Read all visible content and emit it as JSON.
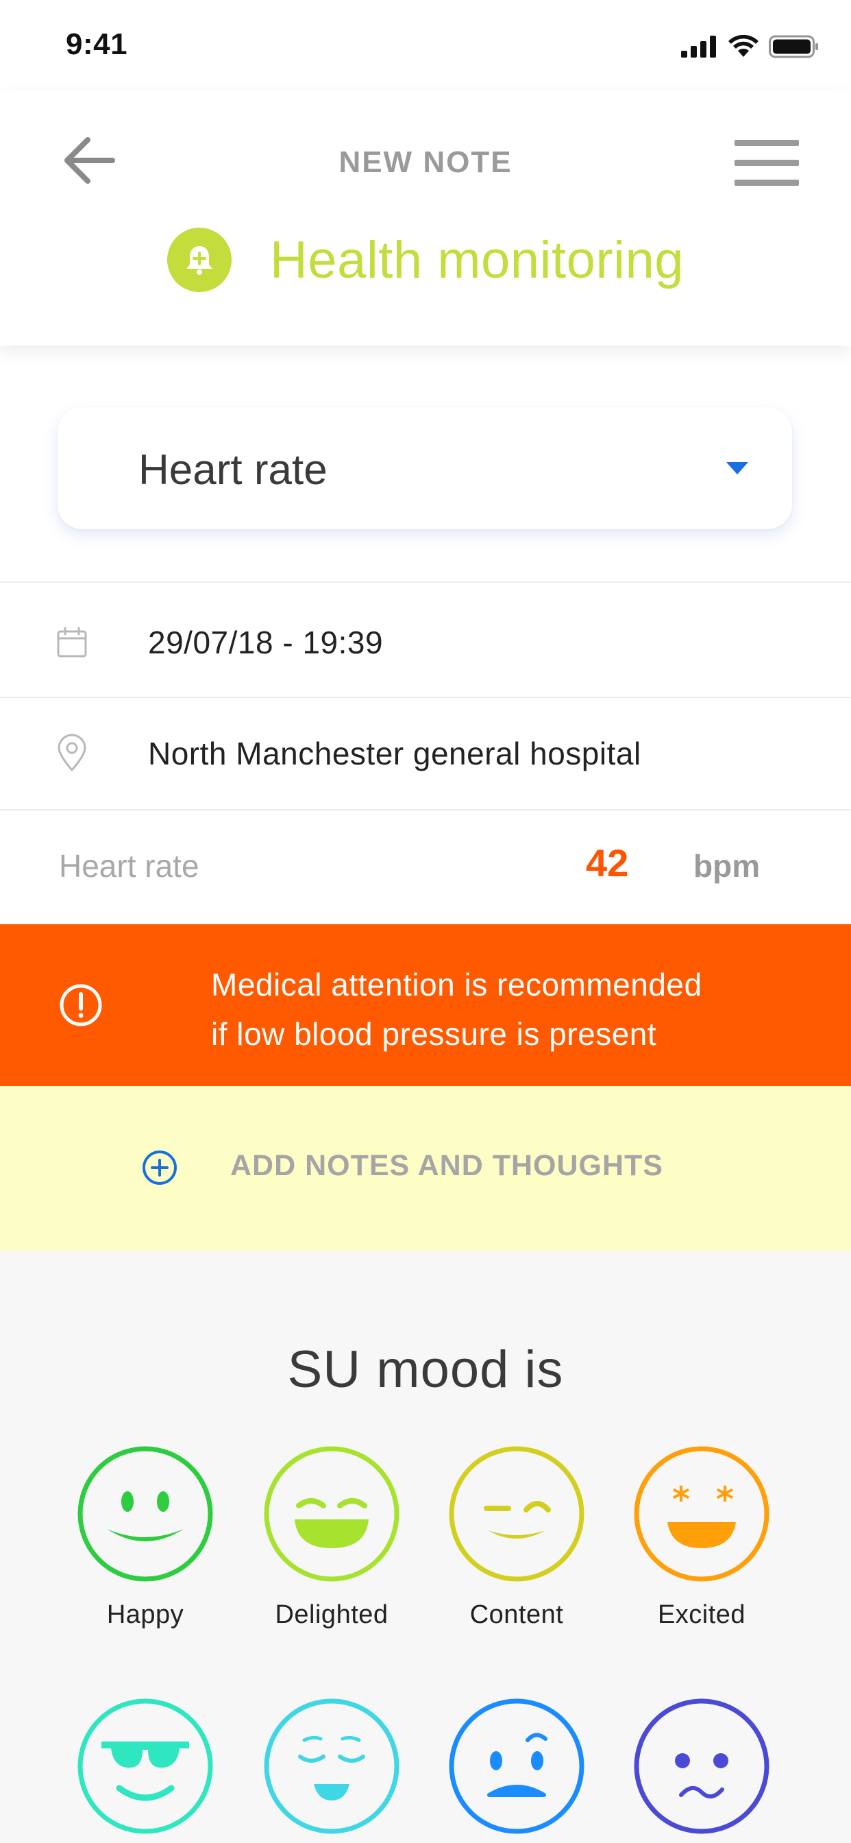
{
  "status_bar": {
    "time": "9:41"
  },
  "header": {
    "title": "NEW NOTE",
    "category": "Health monitoring",
    "accent_color": "#c4dc3c"
  },
  "select": {
    "value": "Heart rate"
  },
  "details": {
    "datetime": "29/07/18 - 19:39",
    "location": "North Manchester general hospital"
  },
  "reading": {
    "label": "Heart rate",
    "value": "42",
    "unit": "bpm",
    "value_color": "#ff5500"
  },
  "alert": {
    "line1": "Medical attention is recommended",
    "line2": "if low blood pressure is present",
    "color": "#ff5a00"
  },
  "notes": {
    "label": "ADD NOTES AND THOUGHTS"
  },
  "mood": {
    "title": "SU mood is",
    "options": [
      {
        "label": "Happy",
        "icon": "happy-face-icon",
        "color": "#2ecc40"
      },
      {
        "label": "Delighted",
        "icon": "delighted-face-icon",
        "color": "#a6e22e"
      },
      {
        "label": "Content",
        "icon": "content-face-icon",
        "color": "#d4cf1e"
      },
      {
        "label": "Excited",
        "icon": "excited-face-icon",
        "color": "#ff9f0a"
      },
      {
        "label": "",
        "icon": "cool-sunglasses-face-icon",
        "color": "#2ee6c0"
      },
      {
        "label": "",
        "icon": "relaxed-face-icon",
        "color": "#3fd6e6"
      },
      {
        "label": "",
        "icon": "confused-face-icon",
        "color": "#1a8cff"
      },
      {
        "label": "",
        "icon": "worried-face-icon",
        "color": "#4a4ad6"
      }
    ]
  }
}
